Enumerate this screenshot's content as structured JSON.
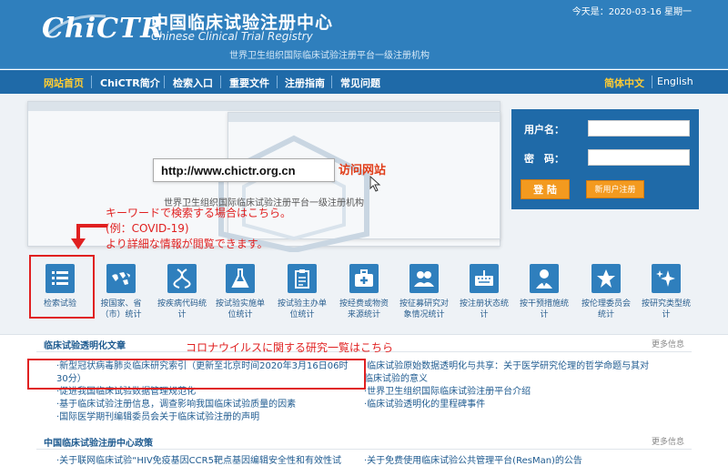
{
  "header": {
    "logo": "ChiCTR",
    "cn_title": "中国临床试验注册中心",
    "en_title": "Chinese Clinical Trial Registry",
    "subtitle": "世界卫生组织国际临床试验注册平台一级注册机构",
    "today": "今天是：2020-03-16 星期一"
  },
  "nav": {
    "items": [
      "网站首页",
      "ChiCTR简介",
      "检索入口",
      "重要文件",
      "注册指南",
      "常见问题"
    ],
    "lang_cn": "简体中文",
    "lang_en": "English"
  },
  "banner": {
    "url": "http://www.chictr.org.cn",
    "visit": "访问网站",
    "sub": "世界卫生组织国际临床试验注册平台一级注册机构"
  },
  "login": {
    "username_label": "用户名：",
    "password_label": "密　码：",
    "login_button": "登 陆",
    "register_button": "新用户注册"
  },
  "annotation": {
    "line1": "キーワードで検索する場合はこちら。",
    "line2": "(例：COVID-19)",
    "line3": "より詳細な情報が閲覧できます。",
    "news_note": "コロナウイルスに関する研究一覧はこちら"
  },
  "icons": [
    {
      "label1": "检索试验",
      "label2": "",
      "icon": "list-icon"
    },
    {
      "label1": "按国家、省",
      "label2": "（市）统计",
      "icon": "world-map-icon"
    },
    {
      "label1": "按疾病代码统",
      "label2": "计",
      "icon": "dna-icon"
    },
    {
      "label1": "按试验实施单",
      "label2": "位统计",
      "icon": "flask-icon"
    },
    {
      "label1": "按试验主办单",
      "label2": "位统计",
      "icon": "clipboard-icon"
    },
    {
      "label1": "按经费或物资",
      "label2": "来源统计",
      "icon": "medkit-icon"
    },
    {
      "label1": "按征募研究对",
      "label2": "象情况统计",
      "icon": "people-icon"
    },
    {
      "label1": "按注册状态统",
      "label2": "计",
      "icon": "keyboard-icon"
    },
    {
      "label1": "按干预措施统",
      "label2": "计",
      "icon": "doctor-icon"
    },
    {
      "label1": "按伦理委员会",
      "label2": "统计",
      "icon": "star-icon"
    },
    {
      "label1": "按研究类型统",
      "label2": "计",
      "icon": "sparkle-icon"
    }
  ],
  "news": {
    "title": "临床试验透明化文章",
    "more": "更多信息",
    "left": [
      "·新型冠状病毒肺炎临床研究索引（更新至北京时间2020年3月16日06时",
      "30分）",
      "·促进我国临床试验数据管理规范化",
      "·基于临床试验注册信息，调查影响我国临床试验质量的因素",
      "·国际医学期刊编辑委员会关于临床试验注册的声明"
    ],
    "right": [
      "·临床试验原始数据透明化与共享：关于医学研究伦理的哲学命题与其对",
      "临床试验的意义",
      "·世界卫生组织国际临床试验注册平台介绍",
      "·临床试验透明化的里程碑事件"
    ]
  },
  "policy": {
    "title": "中国临床试验注册中心政策",
    "more": "更多信息",
    "left": "·关于联网临床试验“HIV免疫基因CCR5靶点基因编辑安全性和有效性试",
    "right": "·关于免费使用临床试验公共管理平台(ResMan)的公告"
  },
  "colors": {
    "header_blue": "#2f7fbd",
    "nav_blue": "#1f6aa8",
    "accent_orange": "#f39a1f",
    "annotation_red": "#e02020"
  }
}
